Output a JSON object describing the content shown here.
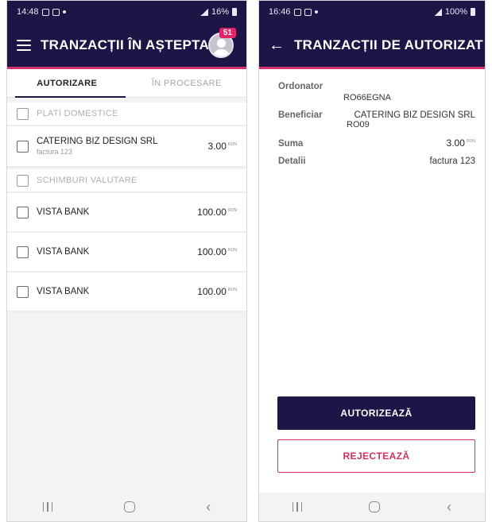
{
  "left": {
    "status": {
      "time": "14:48",
      "battery": "16%"
    },
    "title": "TRANZACȚII ÎN AȘTEPTA...",
    "badge": "51",
    "tabs": [
      {
        "label": "AUTORIZARE"
      },
      {
        "label": "ÎN PROCESARE"
      }
    ],
    "sections": [
      {
        "label": "PLATI DOMESTICE",
        "items": [
          {
            "name": "CATERING BIZ DESIGN SRL",
            "sub": "factura 123",
            "amount": "3.00",
            "currency": "RON"
          }
        ]
      },
      {
        "label": "SCHIMBURI VALUTARE",
        "items": [
          {
            "name": "VISTA BANK",
            "amount": "100.00",
            "currency": "RON"
          },
          {
            "name": "VISTA BANK",
            "amount": "100.00",
            "currency": "RON"
          },
          {
            "name": "VISTA BANK",
            "amount": "100.00",
            "currency": "RON"
          }
        ]
      }
    ]
  },
  "right": {
    "status": {
      "time": "16:46",
      "battery": "100%"
    },
    "title": "TRANZACȚII DE AUTORIZAT",
    "ordonator_label": "Ordonator",
    "ordonator_value": "RO66EGNA",
    "beneficiar_label": "Beneficiar",
    "beneficiar_value": "CATERING BIZ DESIGN SRL",
    "beneficiar_sub": "RO09",
    "suma_label": "Suma",
    "suma_value": "3.00",
    "suma_currency": "RON",
    "detalii_label": "Detalii",
    "detalii_value": "factura 123",
    "authorize_label": "AUTORIZEAZĂ",
    "reject_label": "REJECTEAZĂ"
  },
  "colors": {
    "header": "#1e1446",
    "accent": "#d8306c",
    "badge": "#e0256b"
  },
  "icons": [
    "menu-icon",
    "avatar-icon",
    "back-arrow-icon",
    "checkbox-icon",
    "nav-recent-icon",
    "nav-home-icon",
    "nav-back-icon"
  ]
}
